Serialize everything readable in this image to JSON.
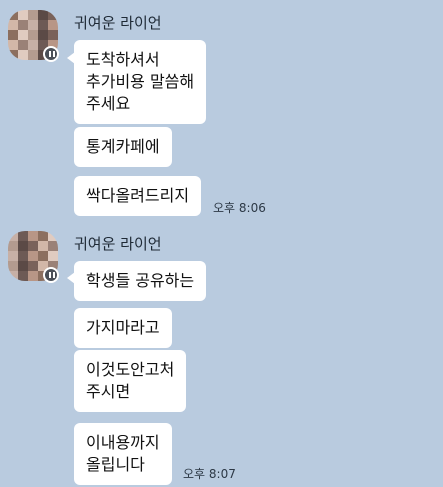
{
  "messages": [
    {
      "sender": "귀여운 라이언",
      "bubbles": [
        "도착하셔서\n추가비용 말씀해\n주세요",
        "통계카페에",
        "싹다올려드리지"
      ],
      "time": "오후 8:06"
    },
    {
      "sender": "귀여운 라이언",
      "bubbles": [
        "학생들 공유하는",
        "가지마라고",
        "이것도안고처\n주시면",
        "이내용까지\n올립니다"
      ],
      "time": "오후 8:07"
    }
  ],
  "colors": {
    "background": "#b9cbdf",
    "bubble": "#ffffff",
    "avatar_pixels": [
      "#8c6f5f",
      "#b89686",
      "#6d5a55",
      "#c7b0a6",
      "#9a8177",
      "#d2b7a8",
      "#7a625a",
      "#5b4a46",
      "#b39b8f",
      "#e0cbc0"
    ]
  }
}
